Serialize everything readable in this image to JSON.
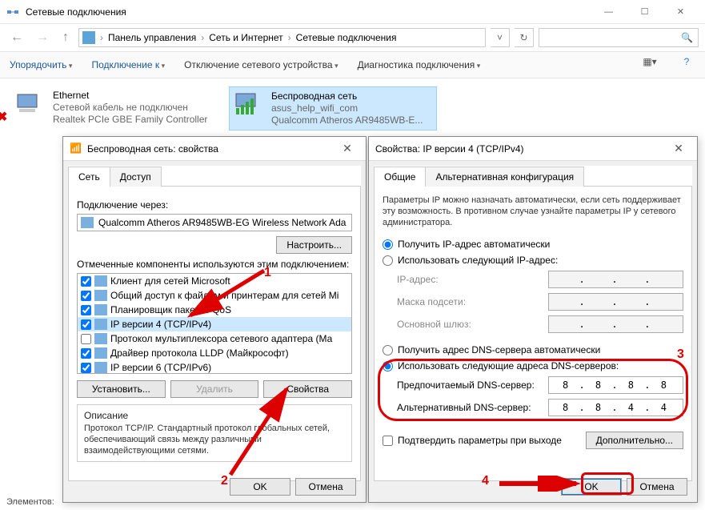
{
  "window": {
    "title": "Сетевые подключения",
    "breadcrumb": [
      "Панель управления",
      "Сеть и Интернет",
      "Сетевые подключения"
    ]
  },
  "toolbar": {
    "organize": "Упорядочить",
    "connect": "Подключение к",
    "disable": "Отключение сетевого устройства",
    "diagnose": "Диагностика подключения"
  },
  "connections": {
    "eth": {
      "name": "Ethernet",
      "status": "Сетевой кабель не подключен",
      "device": "Realtek PCIe GBE Family Controller"
    },
    "wifi": {
      "name": "Беспроводная сеть",
      "status": "asus_help_wifi_com",
      "device": "Qualcomm Atheros AR9485WB-E..."
    }
  },
  "dlg1": {
    "title": "Беспроводная сеть: свойства",
    "tab_net": "Сеть",
    "tab_access": "Доступ",
    "connect_via": "Подключение через:",
    "adapter": "Qualcomm Atheros AR9485WB-EG Wireless Network Ada",
    "configure": "Настроить...",
    "components_label": "Отмеченные компоненты используются этим подключением:",
    "components": [
      {
        "checked": true,
        "label": "Клиент для сетей Microsoft"
      },
      {
        "checked": true,
        "label": "Общий доступ к файлам и принтерам для сетей Mi"
      },
      {
        "checked": true,
        "label": "Планировщик пакетов QoS"
      },
      {
        "checked": true,
        "label": "IP версии 4 (TCP/IPv4)"
      },
      {
        "checked": false,
        "label": "Протокол мультиплексора сетевого адаптера (Ма"
      },
      {
        "checked": true,
        "label": "Драйвер протокола LLDP (Майкрософт)"
      },
      {
        "checked": true,
        "label": "IP версии 6 (TCP/IPv6)"
      }
    ],
    "install": "Установить...",
    "uninstall": "Удалить",
    "properties": "Свойства",
    "desc_title": "Описание",
    "desc_text": "Протокол TCP/IP. Стандартный протокол глобальных сетей, обеспечивающий связь между различными взаимодействующими сетями.",
    "ok": "OK",
    "cancel": "Отмена"
  },
  "dlg2": {
    "title": "Свойства: IP версии 4 (TCP/IPv4)",
    "tab_general": "Общие",
    "tab_alt": "Альтернативная конфигурация",
    "intro": "Параметры IP можно назначать автоматически, если сеть поддерживает эту возможность. В противном случае узнайте параметры IP у сетевого администратора.",
    "ip_auto": "Получить IP-адрес автоматически",
    "ip_manual": "Использовать следующий IP-адрес:",
    "ip_addr": "IP-адрес:",
    "mask": "Маска подсети:",
    "gateway": "Основной шлюз:",
    "dns_auto": "Получить адрес DNS-сервера автоматически",
    "dns_manual": "Использовать следующие адреса DNS-серверов:",
    "dns_pref": "Предпочитаемый DNS-сервер:",
    "dns_pref_val": "8 . 8 . 8 . 8",
    "dns_alt": "Альтернативный DNS-сервер:",
    "dns_alt_val": "8 . 8 . 4 . 4",
    "confirm_exit": "Подтвердить параметры при выходе",
    "advanced": "Дополнительно...",
    "ok": "OK",
    "cancel": "Отмена"
  },
  "statusbar": "Элементов:",
  "annotations": {
    "n1": "1",
    "n2": "2",
    "n3": "3",
    "n4": "4"
  }
}
